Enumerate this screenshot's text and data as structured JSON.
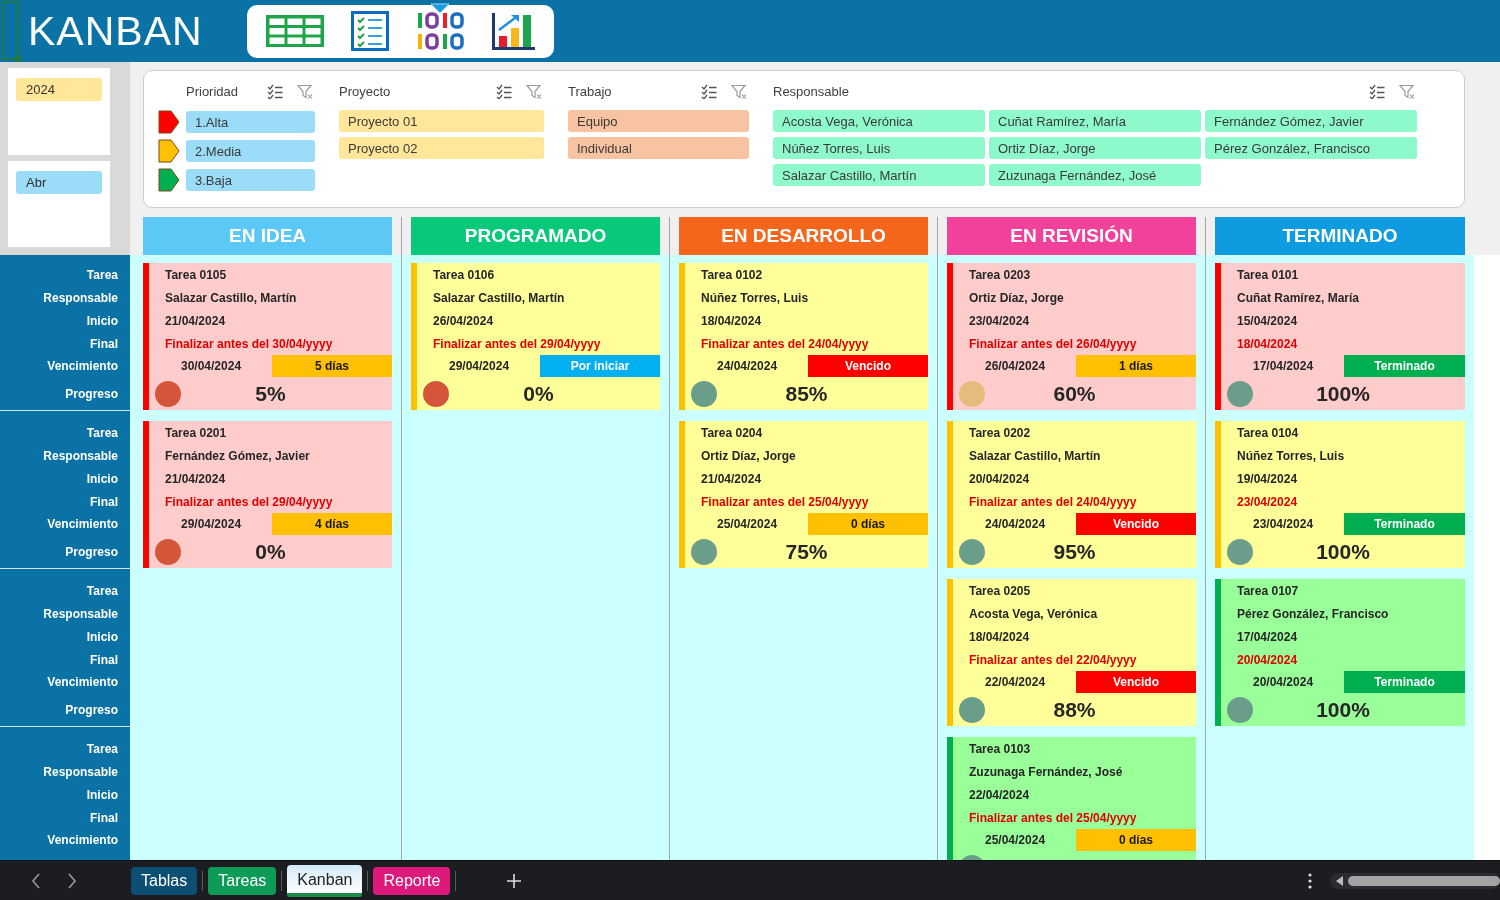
{
  "header": {
    "title": "KANBAN",
    "nav": [
      {
        "kind": "table",
        "selected": false
      },
      {
        "kind": "checklist",
        "selected": false
      },
      {
        "kind": "binary",
        "selected": true
      },
      {
        "kind": "chart",
        "selected": false
      }
    ]
  },
  "slicers": [
    {
      "color": "#ffe699",
      "items": [
        {
          "label": "2024",
          "selected": true
        }
      ]
    },
    {
      "color": "#9bdcf8",
      "items": [
        {
          "label": "Abr",
          "selected": true
        }
      ]
    }
  ],
  "filters": [
    {
      "kind": "priority",
      "title": "Prioridad",
      "color": "#9bdcf8",
      "items": [
        {
          "label": "1.Alta",
          "selected": true,
          "flag": {
            "color": "#ff0000"
          }
        },
        {
          "label": "2.Media",
          "selected": true,
          "flag": {
            "color": "#ffc000"
          }
        },
        {
          "label": "3.Baja",
          "selected": true,
          "flag": {
            "color": "#00b050"
          }
        }
      ]
    },
    {
      "kind": "list",
      "title": "Proyecto",
      "color": "#ffe699",
      "items": [
        {
          "label": "Proyecto 01",
          "selected": true
        },
        {
          "label": "Proyecto 02",
          "selected": true
        }
      ]
    },
    {
      "kind": "list",
      "title": "Trabajo",
      "color": "#f8c3a0",
      "items": [
        {
          "label": "Equipo",
          "selected": true
        },
        {
          "label": "Individual",
          "selected": true
        }
      ]
    },
    {
      "kind": "grid",
      "title": "Responsable",
      "color": "#8ef9cb",
      "items": [
        {
          "label": "Acosta Vega, Verónica",
          "selected": true
        },
        {
          "label": "Cuñat Ramírez, María",
          "selected": true
        },
        {
          "label": "Fernández Gómez, Javier",
          "selected": true
        },
        {
          "label": "Núñez Torres, Luis",
          "selected": true
        },
        {
          "label": "Ortiz Díaz, Jorge",
          "selected": true
        },
        {
          "label": "Pérez González, Francisco",
          "selected": true
        },
        {
          "label": "Salazar Castillo, Martín",
          "selected": true
        },
        {
          "label": "Zuzunaga Fernández, José",
          "selected": true
        }
      ]
    }
  ],
  "row_labels": [
    [
      "Tarea",
      "Responsable",
      "Inicio",
      "Final",
      "Vencimiento",
      "Progreso"
    ],
    [
      "Tarea",
      "Responsable",
      "Inicio",
      "Final",
      "Vencimiento",
      "Progreso"
    ],
    [
      "Tarea",
      "Responsable",
      "Inicio",
      "Final",
      "Vencimiento",
      "Progreso"
    ],
    [
      "Tarea",
      "Responsable",
      "Inicio",
      "Final",
      "Vencimiento"
    ]
  ],
  "columns": [
    {
      "title": "EN IDEA",
      "color": "#5bc8f5",
      "cards": [
        {
          "kind": "high",
          "task": "Tarea 0105",
          "responsible": "Salazar Castillo, Martín",
          "start": "21/04/2024",
          "note": "Finalizar antes del 30/04/yyyy",
          "due": "30/04/2024",
          "status": {
            "kind": "days",
            "label": "5 días"
          },
          "dot": {
            "color": "#d4553a"
          },
          "progress": "5%"
        },
        {
          "kind": "high",
          "task": "Tarea 0201",
          "responsible": "Fernández Gómez, Javier",
          "start": "21/04/2024",
          "note": "Finalizar antes del 29/04/yyyy",
          "due": "29/04/2024",
          "status": {
            "kind": "days",
            "label": "4 días"
          },
          "dot": {
            "color": "#d4553a"
          },
          "progress": "0%"
        }
      ]
    },
    {
      "title": "PROGRAMADO",
      "color": "#08c97a",
      "cards": [
        {
          "kind": "medium",
          "task": "Tarea 0106",
          "responsible": "Salazar Castillo, Martín",
          "start": "26/04/2024",
          "note": "Finalizar antes del 29/04/yyyy",
          "due": "29/04/2024",
          "status": {
            "kind": "not_started",
            "label": "Por iniciar"
          },
          "dot": {
            "color": "#d4553a"
          },
          "progress": "0%"
        }
      ]
    },
    {
      "title": "EN DESARROLLO",
      "color": "#f4661b",
      "cards": [
        {
          "kind": "medium",
          "task": "Tarea 0102",
          "responsible": "Núñez Torres, Luis",
          "start": "18/04/2024",
          "note": "Finalizar antes del 24/04/yyyy",
          "due": "24/04/2024",
          "status": {
            "kind": "overdue",
            "label": "Vencido"
          },
          "dot": {
            "color": "#6a9e8a"
          },
          "progress": "85%"
        },
        {
          "kind": "medium",
          "task": "Tarea 0204",
          "responsible": "Ortiz Díaz, Jorge",
          "start": "21/04/2024",
          "note": "Finalizar antes del 25/04/yyyy",
          "due": "25/04/2024",
          "status": {
            "kind": "days",
            "label": "0 días"
          },
          "dot": {
            "color": "#6a9e8a"
          },
          "progress": "75%"
        }
      ]
    },
    {
      "title": "EN REVISIÓN",
      "color": "#f2419a",
      "cards": [
        {
          "kind": "high",
          "task": "Tarea 0203",
          "responsible": "Ortiz Díaz, Jorge",
          "start": "23/04/2024",
          "note": "Finalizar antes del 26/04/yyyy",
          "due": "26/04/2024",
          "status": {
            "kind": "days",
            "label": "1 días"
          },
          "dot": {
            "color": "#e6bc7d"
          },
          "progress": "60%"
        },
        {
          "kind": "medium",
          "task": "Tarea 0202",
          "responsible": "Salazar Castillo, Martín",
          "start": "20/04/2024",
          "note": "Finalizar antes del 24/04/yyyy",
          "due": "24/04/2024",
          "status": {
            "kind": "overdue",
            "label": "Vencido"
          },
          "dot": {
            "color": "#6a9e8a"
          },
          "progress": "95%"
        },
        {
          "kind": "medium",
          "task": "Tarea 0205",
          "responsible": "Acosta Vega, Verónica",
          "start": "18/04/2024",
          "note": "Finalizar antes del 22/04/yyyy",
          "due": "22/04/2024",
          "status": {
            "kind": "overdue",
            "label": "Vencido"
          },
          "dot": {
            "color": "#6a9e8a"
          },
          "progress": "88%"
        },
        {
          "kind": "low",
          "task": "Tarea 0103",
          "responsible": "Zuzunaga Fernández, José",
          "start": "22/04/2024",
          "note": "Finalizar antes del 25/04/yyyy",
          "due": "25/04/2024",
          "status": {
            "kind": "days",
            "label": "0 días"
          },
          "dot": {
            "color": "#6a9e8a"
          }
        }
      ]
    },
    {
      "title": "TERMINADO",
      "color": "#0f9be0",
      "cards": [
        {
          "kind": "high",
          "task": "Tarea 0101",
          "responsible": "Cuñat Ramírez, María",
          "start": "15/04/2024",
          "note": "18/04/2024",
          "due": "17/04/2024",
          "status": {
            "kind": "done",
            "label": "Terminado"
          },
          "dot": {
            "color": "#6a9e8a"
          },
          "progress": "100%"
        },
        {
          "kind": "medium",
          "task": "Tarea 0104",
          "responsible": "Núñez Torres, Luis",
          "start": "19/04/2024",
          "note": "23/04/2024",
          "due": "23/04/2024",
          "status": {
            "kind": "done",
            "label": "Terminado"
          },
          "dot": {
            "color": "#6a9e8a"
          },
          "progress": "100%"
        },
        {
          "kind": "low",
          "task": "Tarea 0107",
          "responsible": "Pérez González, Francisco",
          "start": "17/04/2024",
          "note": "20/04/2024",
          "due": "20/04/2024",
          "status": {
            "kind": "done",
            "label": "Terminado"
          },
          "dot": {
            "color": "#6a9e8a"
          },
          "progress": "100%"
        }
      ]
    }
  ],
  "sheet_tabs": [
    {
      "label": "Tablas",
      "color": "#0d4e73",
      "selected": false
    },
    {
      "label": "Tareas",
      "color": "#0e9a57",
      "selected": false
    },
    {
      "label": "Kanban",
      "color": "#1e8a4c",
      "selected": true
    },
    {
      "label": "Reporte",
      "color": "#dd1a7b",
      "selected": false
    }
  ]
}
